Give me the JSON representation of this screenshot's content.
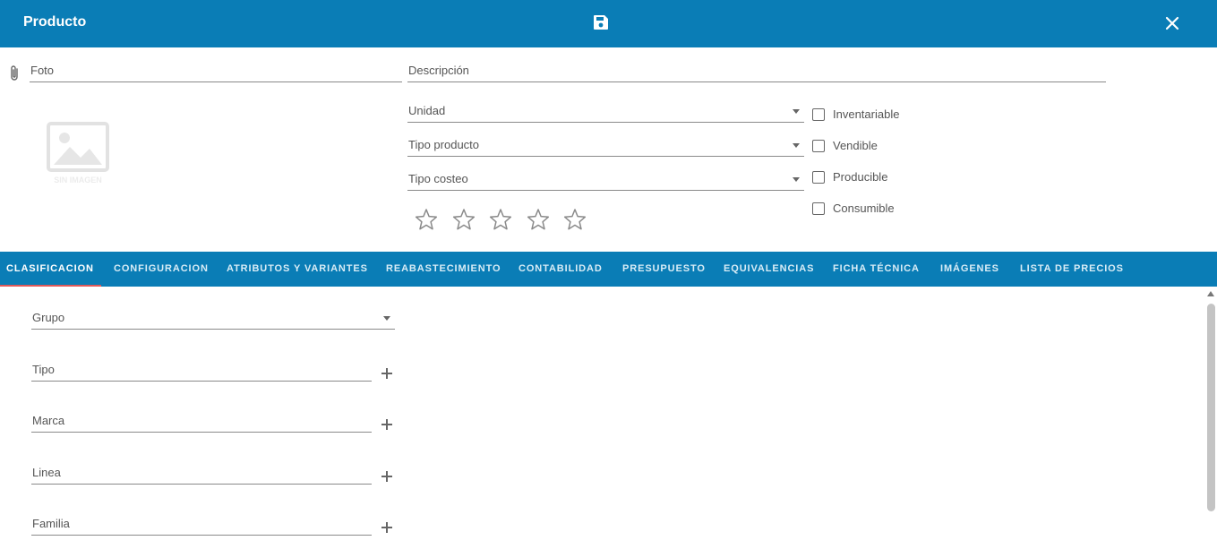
{
  "window": {
    "title": "Producto",
    "save_icon": "floppy-disk-icon",
    "close_icon": "close-icon"
  },
  "header": {
    "foto_label": "Foto",
    "descripcion_label": "Descripción",
    "attach_icon": "paperclip-icon",
    "no_image_icon": "image-placeholder-icon",
    "no_image_text": "SIN IMAGEN"
  },
  "selects": {
    "unidad": "Unidad",
    "tipo_producto": "Tipo producto",
    "tipo_costeo": "Tipo costeo"
  },
  "rating": {
    "max": 5,
    "value": 0
  },
  "checkboxes": [
    {
      "label": "Inventariable",
      "checked": false
    },
    {
      "label": "Vendible",
      "checked": false
    },
    {
      "label": "Producible",
      "checked": false
    },
    {
      "label": "Consumible",
      "checked": false
    }
  ],
  "tabs": [
    "CLASIFICACION",
    "CONFIGURACION",
    "ATRIBUTOS Y VARIANTES",
    "REABASTECIMIENTO",
    "CONTABILIDAD",
    "PRESUPUESTO",
    "EQUIVALENCIAS",
    "FICHA TÉCNICA",
    "IMÁGENES",
    "LISTA DE PRECIOS"
  ],
  "active_tab": "CLASIFICACION",
  "clasificacion": {
    "grupo": "Grupo",
    "tipo": "Tipo",
    "marca": "Marca",
    "linea": "Linea",
    "familia": "Familia"
  },
  "colors": {
    "primary": "#0a7db6",
    "tab_indicator": "#e05a5a"
  }
}
